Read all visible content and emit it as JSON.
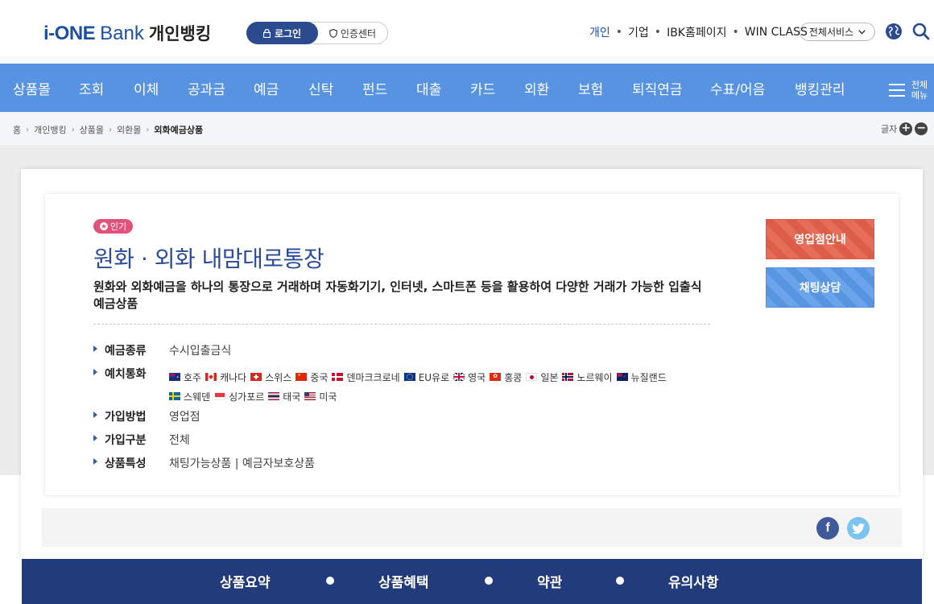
{
  "header": {
    "logo_prefix": "i-ONE",
    "logo_bank": "Bank",
    "logo_kr": "개인뱅킹",
    "login_label": "로그인",
    "cert_label": "인증센터",
    "links": [
      "개인",
      "기업",
      "IBK홈페이지",
      "WIN CLASS"
    ],
    "all_service_label": "전체서비스"
  },
  "nav": {
    "items": [
      "상품몰",
      "조회",
      "이체",
      "공과금",
      "예금",
      "신탁",
      "펀드",
      "대출",
      "카드",
      "외환",
      "보험",
      "퇴직연금",
      "수표/어음",
      "뱅킹관리"
    ],
    "all_menu_label": "전체메뉴"
  },
  "breadcrumb": {
    "items": [
      "홈",
      "개인뱅킹",
      "상품몰",
      "외환몰"
    ],
    "current": "외화예금상품",
    "font_size_label": "글자"
  },
  "product": {
    "badge": "인기",
    "title": "원화 · 외화 내맘대로통장",
    "description": "원화와 외화예금을 하나의 통장으로 거래하며 자동화기기, 인터넷, 스마트폰 등을 활용하여 다양한 거래가 가능한 입출식 예금상품",
    "info": {
      "deposit_type_key": "예금종류",
      "deposit_type_val": "수시입출금식",
      "currency_key": "예치통화",
      "join_method_key": "가입방법",
      "join_method_val": "영업점",
      "join_target_key": "가입구분",
      "join_target_val": "전체",
      "feature_key": "상품특성",
      "feature_val": "채팅가능상품 | 예금자보호상품"
    },
    "currencies": [
      "호주",
      "캐나다",
      "스위스",
      "중국",
      "덴마크크로네",
      "EU유로",
      "영국",
      "홍콩",
      "일본",
      "노르웨이",
      "뉴질랜드",
      "스웨덴",
      "싱가포르",
      "태국",
      "미국"
    ],
    "branch_button": "영업점안내",
    "chat_button": "채팅상담"
  },
  "tabs": [
    "상품요약",
    "상품혜택",
    "약관",
    "유의사항"
  ],
  "colors": {
    "nav_bg": "#5793e0",
    "title_blue": "#2b4a9a",
    "tabbar_bg": "#223b7a",
    "branch_btn": "#e4614a",
    "chat_btn": "#5a9ae8",
    "badge_pink": "#e0527a"
  }
}
